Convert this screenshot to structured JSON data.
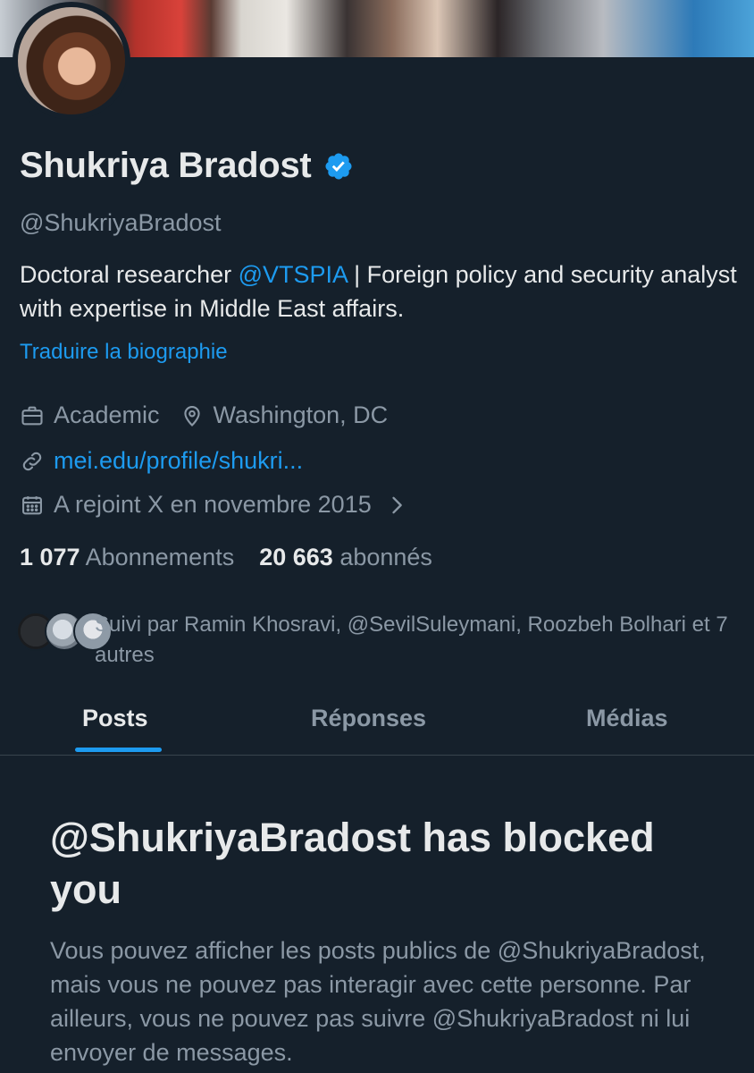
{
  "profile": {
    "name": "Shukriya Bradost",
    "handle": "@ShukriyaBradost",
    "bio_part1": "Doctoral researcher ",
    "bio_mention": "@VTSPIA",
    "bio_part2": " | Foreign policy and security analyst with expertise in Middle East affairs.",
    "translate_bio": "Traduire la biographie",
    "category": "Academic",
    "location": "Washington, DC",
    "website": "mei.edu/profile/shukri...",
    "joined": "A rejoint X en novembre 2015",
    "following_count": "1 077",
    "following_label": "Abonnements",
    "followers_count": "20 663",
    "followers_label": "abonnés",
    "followed_by": "Suivi par Ramin Khosravi, @SevilSuleymani, Roozbeh Bolhari et 7 autres"
  },
  "tabs": [
    {
      "label": "Posts",
      "active": true
    },
    {
      "label": "Réponses",
      "active": false
    },
    {
      "label": "Médias",
      "active": false
    }
  ],
  "blocked": {
    "title": "@ShukriyaBradost has blocked you",
    "message": "Vous pouvez afficher les posts publics de @ShukriyaBradost, mais vous ne pouvez pas interagir avec cette personne. Par ailleurs, vous ne pouvez pas suivre @ShukriyaBradost ni lui envoyer de messages."
  },
  "icons": {
    "verified": "verified-badge-icon",
    "category": "briefcase-icon",
    "location": "location-pin-icon",
    "website": "link-icon",
    "joined": "calendar-icon",
    "chevron": "chevron-right-icon"
  },
  "colors": {
    "background": "#15202b",
    "accent": "#1d9bf0",
    "text_primary": "#e7e9ea",
    "text_secondary": "#8b98a5"
  }
}
